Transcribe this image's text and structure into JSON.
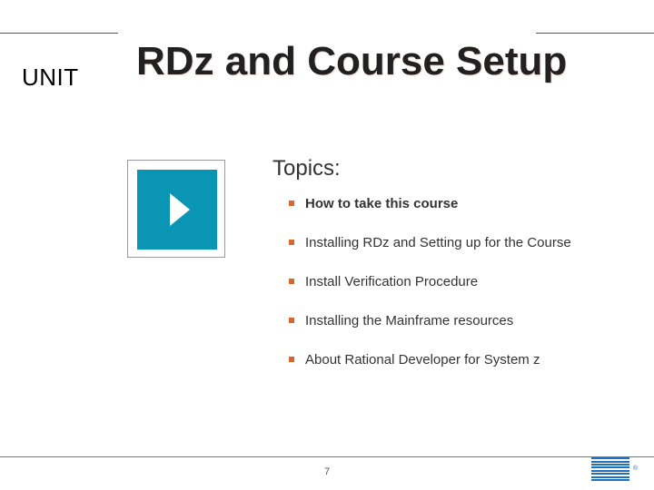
{
  "unit_label": "UNIT",
  "unit_title": "RDz and Course Setup",
  "topics_heading": "Topics:",
  "topics": [
    {
      "label": "How to take this course",
      "bold": true
    },
    {
      "label": "Installing RDz and Setting up for the Course",
      "bold": false
    },
    {
      "label": "Install Verification Procedure",
      "bold": false
    },
    {
      "label": "Installing the Mainframe resources",
      "bold": false
    },
    {
      "label": "About Rational Developer for System z",
      "bold": false
    }
  ],
  "page_number": "7",
  "logo_registered": "®"
}
